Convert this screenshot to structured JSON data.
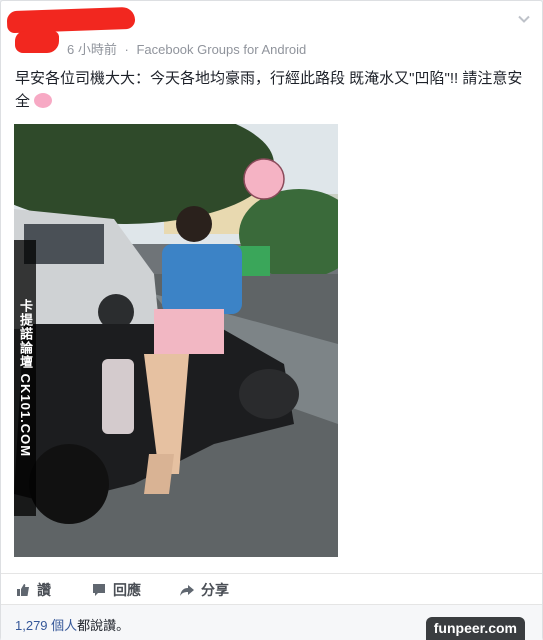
{
  "post": {
    "time": "6 小時前",
    "separator": "·",
    "source": "Facebook Groups for Android",
    "text": "早安各位司機大大：今天各地均豪雨，行經此路段 既淹水又\"凹陷\"!! 請注意安全",
    "image_watermark": "卡提諾論壇 CK101.COM"
  },
  "actions": [
    {
      "label": "讚",
      "icon": "thumbs-up-icon"
    },
    {
      "label": "回應",
      "icon": "comment-icon"
    },
    {
      "label": "分享",
      "icon": "share-icon"
    }
  ],
  "likes": {
    "count": "1,279",
    "unit": " 個人",
    "suffix": "都說讚。"
  },
  "branding": {
    "site": "funpeer.com"
  },
  "colors": {
    "link": "#365899",
    "redaction": "#f2271f",
    "meta": "#90949c"
  }
}
